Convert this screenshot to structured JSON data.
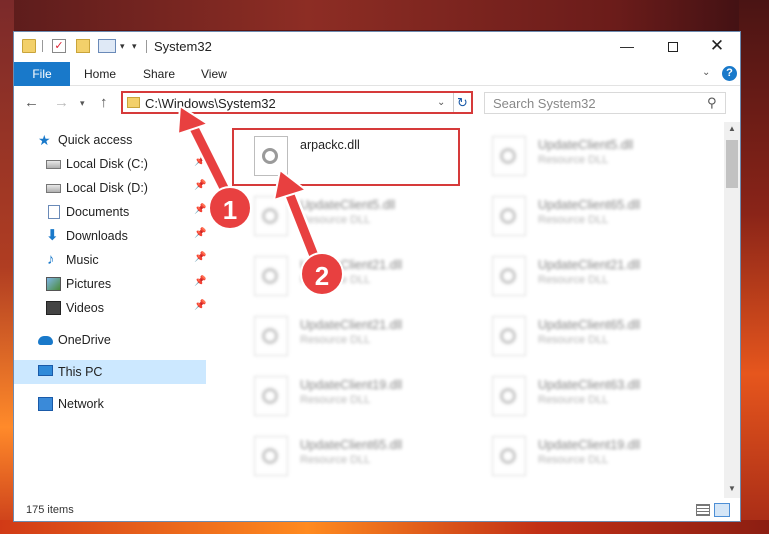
{
  "window": {
    "title": "System32",
    "minimize_symbol": "—",
    "close_symbol": "✕"
  },
  "ribbon": {
    "file": "File",
    "home": "Home",
    "share": "Share",
    "view": "View",
    "help": "?"
  },
  "nav": {
    "address": "C:\\Windows\\System32",
    "search_placeholder": "Search System32"
  },
  "sidebar": {
    "items": [
      {
        "label": "Quick access"
      },
      {
        "label": "Local Disk (C:)"
      },
      {
        "label": "Local Disk (D:)"
      },
      {
        "label": "Documents"
      },
      {
        "label": "Downloads"
      },
      {
        "label": "Music"
      },
      {
        "label": "Pictures"
      },
      {
        "label": "Videos"
      },
      {
        "label": "OneDrive"
      },
      {
        "label": "This PC"
      },
      {
        "label": "Network"
      }
    ]
  },
  "files": [
    {
      "name": "arpackc.dll",
      "type": ""
    },
    {
      "name": "UpdateClient5.dll",
      "type": "Resource DLL"
    },
    {
      "name": "UpdateClient5.dll",
      "type": "Resource DLL"
    },
    {
      "name": "UpdateClient65.dll",
      "type": "Resource DLL"
    },
    {
      "name": "UpdateClient21.dll",
      "type": "Resource DLL"
    },
    {
      "name": "UpdateClient21.dll",
      "type": "Resource DLL"
    },
    {
      "name": "UpdateClient21.dll",
      "type": "Resource DLL"
    },
    {
      "name": "UpdateClient65.dll",
      "type": "Resource DLL"
    },
    {
      "name": "UpdateClient19.dll",
      "type": "Resource DLL"
    },
    {
      "name": "UpdateClient63.dll",
      "type": "Resource DLL"
    },
    {
      "name": "UpdateClient65.dll",
      "type": "Resource DLL"
    },
    {
      "name": "UpdateClient19.dll",
      "type": "Resource DLL"
    }
  ],
  "status": {
    "count": "175 items"
  },
  "markers": {
    "one": "1",
    "two": "2"
  },
  "colors": {
    "accent": "#1979ca",
    "highlight": "#d63a3a",
    "selected": "#cce8ff"
  }
}
